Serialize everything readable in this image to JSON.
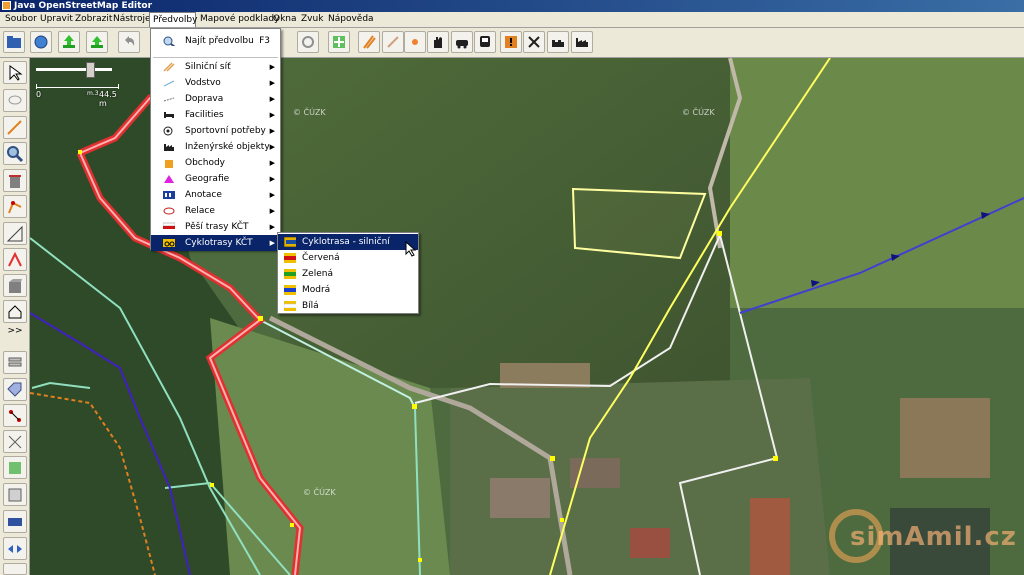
{
  "window": {
    "title": "Java OpenStreetMap Editor"
  },
  "menubar": [
    {
      "label": "Soubor"
    },
    {
      "label": "Upravit"
    },
    {
      "label": "Zobrazit"
    },
    {
      "label": "Nástroje"
    },
    {
      "label": "Předvolby",
      "open": true
    },
    {
      "label": "Mapové podklady"
    },
    {
      "label": "Okna"
    },
    {
      "label": "Zvuk"
    },
    {
      "label": "Nápověda"
    }
  ],
  "presets_menu": {
    "search": {
      "label": "Najít předvolbu",
      "shortcut": "F3",
      "icon": "search-preset-icon"
    },
    "items": [
      {
        "label": "Silniční síť",
        "icon": "road-icon"
      },
      {
        "label": "Vodstvo",
        "icon": "water-icon"
      },
      {
        "label": "Doprava",
        "icon": "transport-icon"
      },
      {
        "label": "Facilities",
        "icon": "bed-icon"
      },
      {
        "label": "Sportovní potřeby",
        "icon": "sport-icon"
      },
      {
        "label": "Inženýrské objekty",
        "icon": "factory-icon"
      },
      {
        "label": "Obchody",
        "icon": "shop-icon"
      },
      {
        "label": "Geografie",
        "icon": "peak-icon"
      },
      {
        "label": "Anotace",
        "icon": "annotation-icon"
      },
      {
        "label": "Relace",
        "icon": "relation-icon"
      },
      {
        "label": "Pěší trasy KČT",
        "icon": "hiking-route-icon"
      },
      {
        "label": "Cyklotrasy KČT",
        "icon": "cycle-route-icon",
        "highlighted": true
      }
    ]
  },
  "cycle_submenu": {
    "items": [
      {
        "label": "Cyklotrasa - silniční značení",
        "highlighted": true,
        "colors": [
          "#e0b000",
          "#1a4fa0"
        ]
      },
      {
        "label": "Červená",
        "colors": [
          "#f0c000",
          "#d01010"
        ]
      },
      {
        "label": "Zelená",
        "colors": [
          "#f0c000",
          "#20a020"
        ]
      },
      {
        "label": "Modrá",
        "colors": [
          "#f0c000",
          "#1a3fd0"
        ]
      },
      {
        "label": "Bílá",
        "colors": [
          "#f0c000",
          "#ffffff"
        ]
      }
    ]
  },
  "scale": {
    "zero": "0",
    "value": "44.5 m",
    "small": "m.3"
  },
  "map": {
    "imagery_credits": [
      "© ČÚZK",
      "© ČÚZK",
      "© ČÚZK"
    ],
    "watermark": "simAmil.cz"
  },
  "colors": {
    "selected_way": "#e03030",
    "boundary": "#ffffa0",
    "cycleway": "#2020c0",
    "landuse": "#90e0c0"
  }
}
